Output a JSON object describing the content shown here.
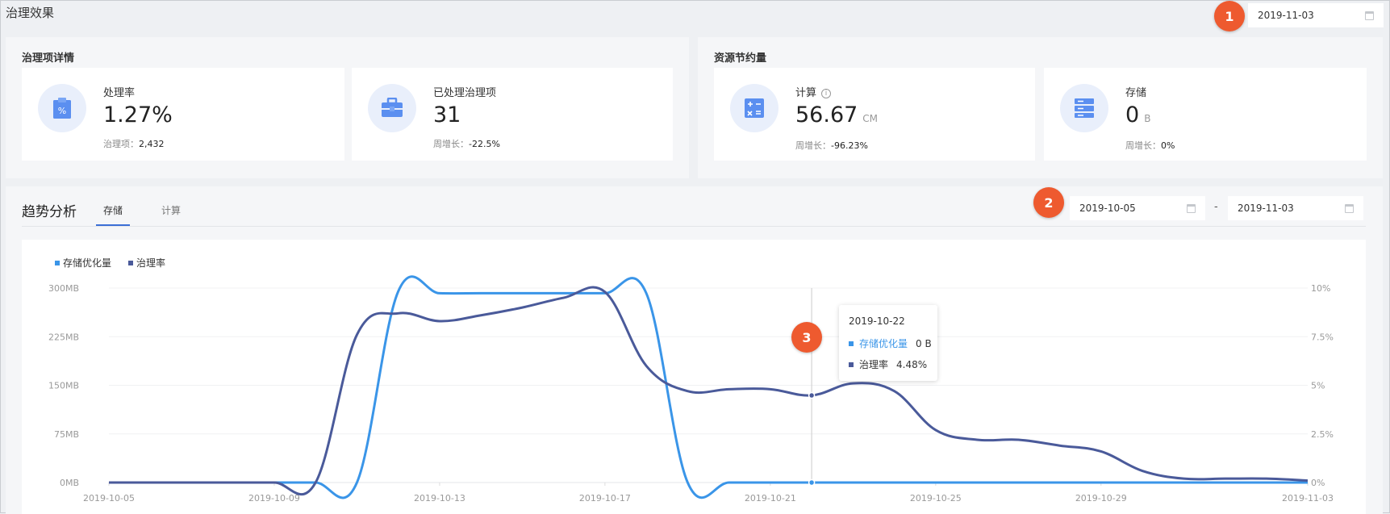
{
  "page": {
    "title": "治理效果",
    "date": "2019-11-03"
  },
  "badges": [
    "1",
    "2",
    "3"
  ],
  "governance": {
    "title": "治理项详情",
    "rate": {
      "label": "处理率",
      "value": "1.27%",
      "sub_label": "治理项：",
      "sub_value": "2,432",
      "icon": "percent-clipboard-icon"
    },
    "processed": {
      "label": "已处理治理项",
      "value": "31",
      "sub_label": "周增长：",
      "sub_value": "-22.5%",
      "icon": "toolbox-icon"
    }
  },
  "savings": {
    "title": "资源节约量",
    "compute": {
      "label": "计算",
      "value": "56.67",
      "unit": "CM",
      "sub_label": "周增长：",
      "sub_value": "-96.23%",
      "icon": "calculator-icon"
    },
    "storage": {
      "label": "存储",
      "value": "0",
      "unit": "B",
      "sub_label": "周增长：",
      "sub_value": "0%",
      "icon": "server-storage-icon"
    }
  },
  "trend": {
    "title": "趋势分析",
    "tabs": [
      "存储",
      "计算"
    ],
    "active_tab": "存储",
    "start_date": "2019-10-05",
    "end_date": "2019-11-03",
    "separator": "-"
  },
  "colors": {
    "storage": "#3a95e8",
    "rate": "#4a5a9a",
    "accent": "#3b6fd6",
    "badge": "#ee5a2f"
  },
  "tooltip": {
    "date": "2019-10-22",
    "rows": [
      {
        "name": "存储优化量",
        "value": "0 B"
      },
      {
        "name": "治理率",
        "value": "4.48%"
      }
    ]
  },
  "chart_data": {
    "type": "line",
    "legend": [
      "存储优化量",
      "治理率"
    ],
    "legend_position": "top-left",
    "x_ticks": [
      "2019-10-05",
      "2019-10-09",
      "2019-10-13",
      "2019-10-17",
      "2019-10-21",
      "2019-10-25",
      "2019-10-29",
      "2019-11-03"
    ],
    "y_left_ticks": [
      "0MB",
      "75MB",
      "150MB",
      "225MB",
      "300MB"
    ],
    "y_right_ticks": [
      "0%",
      "2.5%",
      "5%",
      "7.5%",
      "10%"
    ],
    "y_left_range": [
      0,
      300
    ],
    "y_right_range": [
      0,
      10
    ],
    "series": [
      {
        "name": "存储优化量",
        "axis": "left",
        "x": [
          "2019-10-05",
          "2019-10-06",
          "2019-10-07",
          "2019-10-08",
          "2019-10-09",
          "2019-10-10",
          "2019-10-11",
          "2019-10-12",
          "2019-10-13",
          "2019-10-14",
          "2019-10-15",
          "2019-10-16",
          "2019-10-17",
          "2019-10-18",
          "2019-10-19",
          "2019-10-20",
          "2019-10-21",
          "2019-10-22",
          "2019-10-23",
          "2019-10-24",
          "2019-10-25",
          "2019-10-26",
          "2019-10-27",
          "2019-10-28",
          "2019-10-29",
          "2019-10-30",
          "2019-10-31",
          "2019-11-01",
          "2019-11-02",
          "2019-11-03"
        ],
        "values": [
          0,
          0,
          0,
          0,
          0,
          0,
          0,
          295,
          292,
          292,
          292,
          292,
          292,
          292,
          0,
          0,
          0,
          0,
          0,
          0,
          0,
          0,
          0,
          0,
          0,
          0,
          0,
          0,
          0,
          0
        ]
      },
      {
        "name": "治理率",
        "axis": "right",
        "x": [
          "2019-10-05",
          "2019-10-06",
          "2019-10-07",
          "2019-10-08",
          "2019-10-09",
          "2019-10-10",
          "2019-10-11",
          "2019-10-12",
          "2019-10-13",
          "2019-10-14",
          "2019-10-15",
          "2019-10-16",
          "2019-10-17",
          "2019-10-18",
          "2019-10-19",
          "2019-10-20",
          "2019-10-21",
          "2019-10-22",
          "2019-10-23",
          "2019-10-24",
          "2019-10-25",
          "2019-10-26",
          "2019-10-27",
          "2019-10-28",
          "2019-10-29",
          "2019-10-30",
          "2019-10-31",
          "2019-11-01",
          "2019-11-02",
          "2019-11-03"
        ],
        "values": [
          0,
          0,
          0,
          0,
          0,
          0,
          7.6,
          8.7,
          8.3,
          8.6,
          9.0,
          9.5,
          9.8,
          6.0,
          4.7,
          4.8,
          4.8,
          4.48,
          5.1,
          4.7,
          2.7,
          2.2,
          2.2,
          1.9,
          1.6,
          0.6,
          0.2,
          0.2,
          0.2,
          0.1
        ]
      }
    ],
    "tooltip_x": "2019-10-22"
  }
}
